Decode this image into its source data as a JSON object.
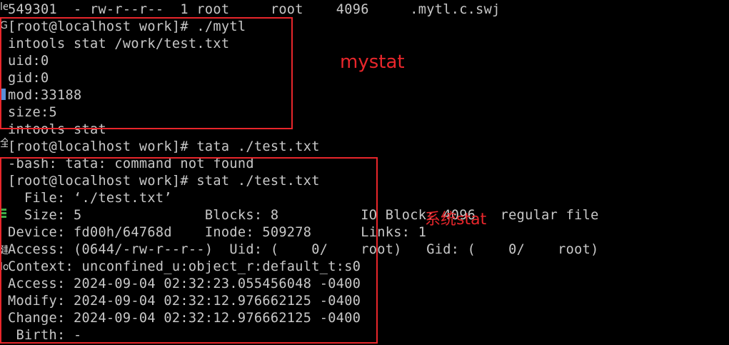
{
  "terminal": {
    "lines": [
      "549301  - rw-r--r--  1 root     root    4096     .mytl.c.swj",
      "[root@localhost work]# ./mytl",
      "intools stat /work/test.txt",
      "uid:0",
      "gid:0",
      "mod:33188",
      "size:5",
      "intools stat",
      "[root@localhost work]# tata ./test.txt",
      "-bash: tata: command not found",
      "[root@localhost work]# stat ./test.txt",
      "  File: ‘./test.txt’",
      "  Size: 5               Blocks: 8          IO Block: 4096   regular file",
      "Device: fd00h/64768d    Inode: 509278      Links: 1",
      "Access: (0644/-rw-r--r--)  Uid: (    0/    root)   Gid: (    0/    root)",
      "Context: unconfined_u:object_r:default_t:s0",
      "Access: 2024-09-04 02:32:23.055456048 -0400",
      "Modify: 2024-09-04 02:32:12.976662125 -0400",
      "Change: 2024-09-04 02:32:12.976662125 -0400",
      " Birth: -"
    ]
  },
  "annotations": {
    "mystat_label": "mystat",
    "system_stat_label": "系统stat",
    "color": "#e8262b"
  },
  "left_edge_glyphs": [
    "le",
    "G",
    "全",
    "建",
    "lo"
  ]
}
